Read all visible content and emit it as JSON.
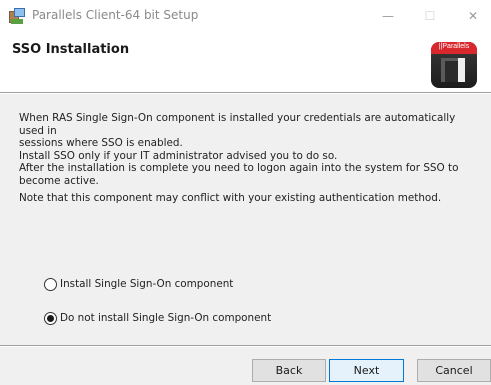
{
  "window": {
    "title": "Parallels Client-64 bit Setup",
    "controls": {
      "minimize": "—",
      "maximize": "☐",
      "close": "✕"
    }
  },
  "header": {
    "title": "SSO Installation",
    "logo_text": "||Parallels"
  },
  "body": {
    "description_lines": [
      "When RAS Single Sign-On component is installed your credentials are automatically used in",
      "sessions where SSO is enabled.",
      "Install SSO only if your IT administrator advised you to do so.",
      "After the installation is complete you need to logon again into the system for SSO to",
      "become active."
    ],
    "note": "Note that this component may conflict with your existing authentication method."
  },
  "options": {
    "install": {
      "label": "Install Single Sign-On component",
      "selected": false
    },
    "do_not_install": {
      "label": "Do not install Single Sign-On component",
      "selected": true
    }
  },
  "buttons": {
    "back": "Back",
    "next": "Next",
    "cancel": "Cancel"
  },
  "colors": {
    "brand_red": "#d9272e",
    "focus_blue": "#0078d7"
  }
}
